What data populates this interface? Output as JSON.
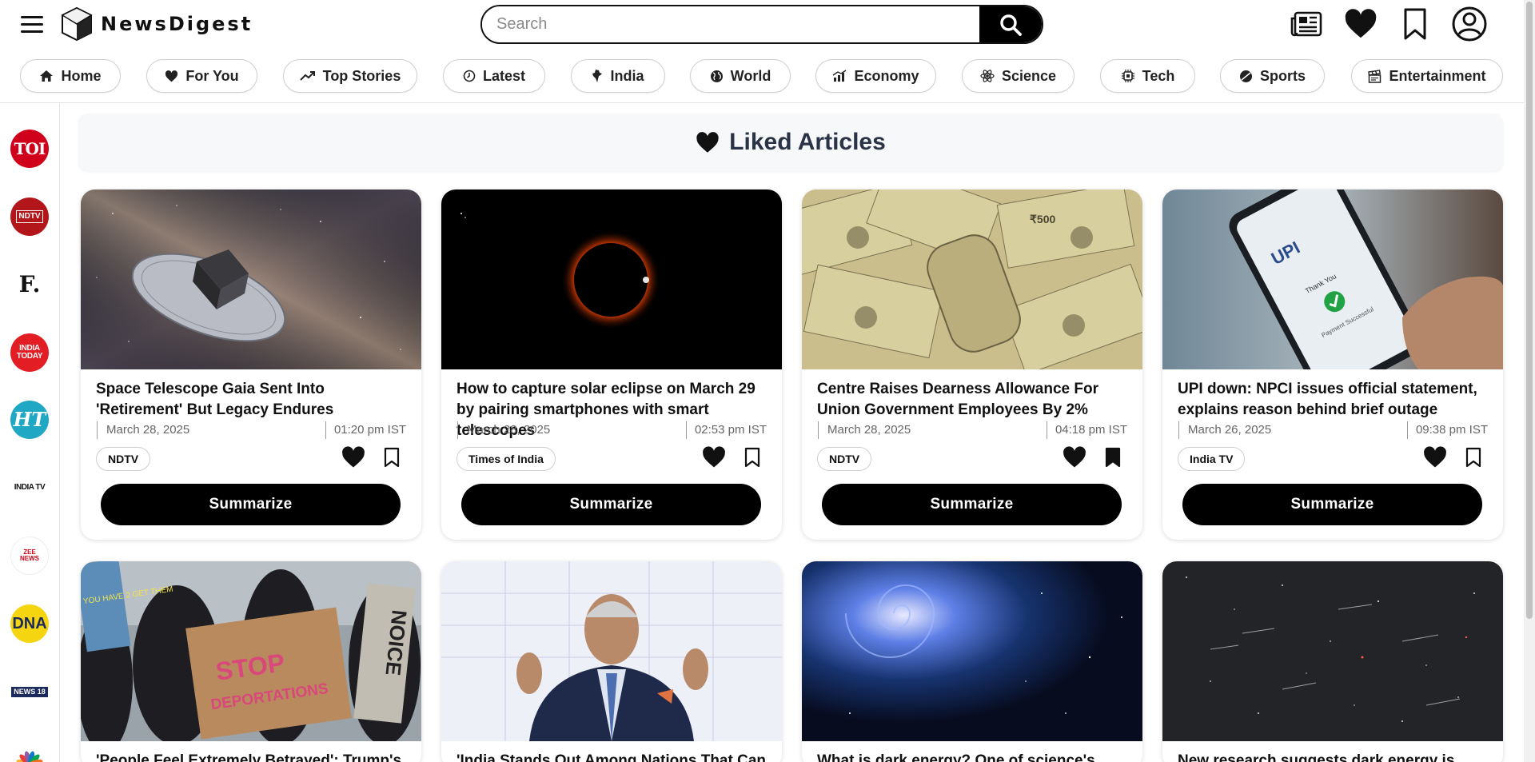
{
  "app": {
    "name": "NewsDigest"
  },
  "search": {
    "placeholder": "Search"
  },
  "header_icons": [
    "newspaper-icon",
    "heart-icon",
    "bookmark-icon",
    "user-icon"
  ],
  "categories": [
    {
      "label": "Home",
      "icon": "home-icon"
    },
    {
      "label": "For You",
      "icon": "heart-icon"
    },
    {
      "label": "Top Stories",
      "icon": "trending-icon"
    },
    {
      "label": "Latest",
      "icon": "clock-icon"
    },
    {
      "label": "India",
      "icon": "india-map-icon"
    },
    {
      "label": "World",
      "icon": "globe-icon"
    },
    {
      "label": "Economy",
      "icon": "economy-chart-icon"
    },
    {
      "label": "Science",
      "icon": "atom-icon"
    },
    {
      "label": "Tech",
      "icon": "chip-icon"
    },
    {
      "label": "Sports",
      "icon": "ball-icon"
    },
    {
      "label": "Entertainment",
      "icon": "clapperboard-icon"
    }
  ],
  "sources": [
    {
      "logo": "TOI"
    },
    {
      "logo": "NDTV"
    },
    {
      "logo": "F."
    },
    {
      "logo": "INDIA TODAY"
    },
    {
      "logo": "HT"
    },
    {
      "logo": "INDIA TV"
    },
    {
      "logo": "ZEE NEWS"
    },
    {
      "logo": "DNA"
    },
    {
      "logo": "NEWS 18"
    },
    {
      "logo": "CNBC"
    }
  ],
  "page": {
    "heading": "Liked Articles"
  },
  "summarize_label": "Summarize",
  "articles": [
    {
      "title": "Space Telescope Gaia Sent Into 'Retirement' But Legacy Endures",
      "date": "March 28, 2025",
      "time": "01:20 pm IST",
      "source": "NDTV",
      "liked": true,
      "bookmarked": false
    },
    {
      "title": "How to capture solar eclipse on March 29 by pairing smartphones with smart telescopes",
      "date": "March 28, 2025",
      "time": "02:53 pm IST",
      "source": "Times of India",
      "liked": true,
      "bookmarked": false
    },
    {
      "title": "Centre Raises Dearness Allowance For Union Government Employees By 2%",
      "date": "March 28, 2025",
      "time": "04:18 pm IST",
      "source": "NDTV",
      "liked": true,
      "bookmarked": true
    },
    {
      "title": "UPI down: NPCI issues official statement, explains reason behind brief outage",
      "date": "March 26, 2025",
      "time": "09:38 pm IST",
      "source": "India TV",
      "liked": true,
      "bookmarked": false
    },
    {
      "title": "'People Feel Extremely Betrayed': Trump's",
      "date": "",
      "time": "",
      "source": "",
      "liked": true,
      "bookmarked": false
    },
    {
      "title": "'India Stands Out Among Nations That Can",
      "date": "",
      "time": "",
      "source": "",
      "liked": true,
      "bookmarked": false
    },
    {
      "title": "What is dark energy? One of science's great",
      "date": "",
      "time": "",
      "source": "",
      "liked": true,
      "bookmarked": false
    },
    {
      "title": "New research suggests dark energy is",
      "date": "",
      "time": "",
      "source": "",
      "liked": true,
      "bookmarked": false
    }
  ],
  "image_texts": {
    "upi_logo": "UPI",
    "upi_thanks": "Thank You",
    "upi_status": "Payment Successful",
    "protest_sign_1": "STOP",
    "protest_sign_2": "DEPORTATIONS",
    "protest_sign_3": "NOICE",
    "protest_sign_4": "YOU HAVE 2 GET THEM",
    "banknote_value": "₹500"
  },
  "colors": {
    "accent": "#000000",
    "banner_bg": "#f6f8fa",
    "heading": "#2a3446",
    "toi_red": "#d0021b",
    "ndtv_red": "#b3161a",
    "ht_teal": "#1fa7c4",
    "dna_yellow": "#f5d410"
  }
}
